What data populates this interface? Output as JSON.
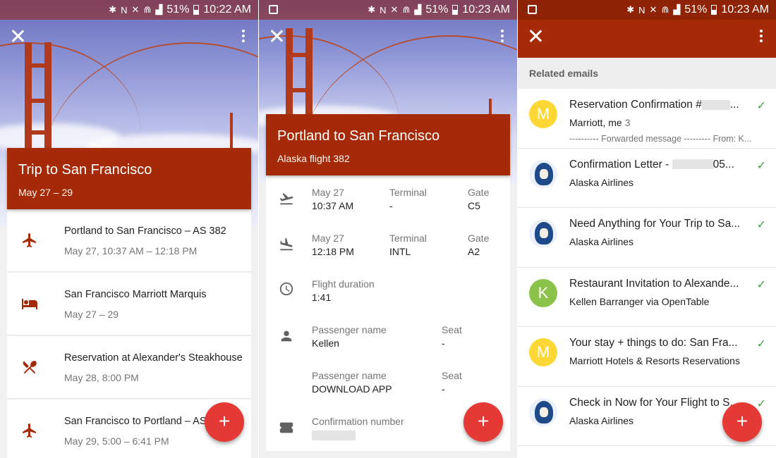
{
  "status_bars": [
    {
      "battery": "51%",
      "time": "10:22 AM"
    },
    {
      "battery": "51%",
      "time": "10:23 AM"
    },
    {
      "battery": "51%",
      "time": "10:23 AM"
    }
  ],
  "trip": {
    "title": "Trip to San Francisco",
    "dates": "May 27 – 29",
    "items": [
      {
        "icon": "airplane-icon",
        "title": "Portland to San Francisco – AS 382",
        "subtitle": "May 27, 10:37 AM – 12:18 PM"
      },
      {
        "icon": "hotel-bed-icon",
        "title": "San Francisco Marriott Marquis",
        "subtitle": "May 27 – 29"
      },
      {
        "icon": "restaurant-icon",
        "title": "Reservation at Alexander's Steakhouse",
        "subtitle": "May 28, 8:00 PM"
      },
      {
        "icon": "airplane-icon",
        "title": "San Francisco to Portland – AS",
        "subtitle": "May 29, 5:00 – 6:41 PM"
      }
    ]
  },
  "flight": {
    "title": "Portland to San Francisco",
    "subtitle": "Alaska flight 382",
    "departure": {
      "date": "May 27",
      "time": "10:37 AM",
      "terminal_label": "Terminal",
      "terminal": "-",
      "gate_label": "Gate",
      "gate": "C5"
    },
    "arrival": {
      "date": "May 27",
      "time": "12:18 PM",
      "terminal_label": "Terminal",
      "terminal": "INTL",
      "gate_label": "Gate",
      "gate": "A2"
    },
    "duration": {
      "label": "Flight duration",
      "value": "1:41"
    },
    "passengers": [
      {
        "label": "Passenger name",
        "name": "Kellen",
        "seat_label": "Seat",
        "seat": "-"
      },
      {
        "label": "Passenger name",
        "name": "DOWNLOAD APP",
        "seat_label": "Seat",
        "seat": "-"
      }
    ],
    "confirmation_label": "Confirmation number"
  },
  "emails": {
    "header": "Related emails",
    "items": [
      {
        "avatar": "M",
        "avatar_color": "#fdd835",
        "subject": "Reservation Confirmation #",
        "subject_suffix": "...",
        "from": "Marriott, me",
        "count": "3",
        "snippet": "---------- Forwarded message --------- From: K..."
      },
      {
        "avatar": "",
        "avatar_color": "#eaf1fa",
        "subject": "Confirmation Letter - ",
        "subject_suffix": "05...",
        "from": "Alaska Airlines",
        "count": "",
        "snippet": ""
      },
      {
        "avatar": "",
        "avatar_color": "#eaf1fa",
        "subject": "Need Anything for Your Trip to Sa...",
        "subject_suffix": "",
        "from": "Alaska Airlines",
        "count": "",
        "snippet": ""
      },
      {
        "avatar": "K",
        "avatar_color": "#8bc34a",
        "subject": "Restaurant Invitation to Alexande...",
        "subject_suffix": "",
        "from": "Kellen Barranger via OpenTable",
        "count": "",
        "snippet": ""
      },
      {
        "avatar": "M",
        "avatar_color": "#fdd835",
        "subject": "Your stay + things to do: San Fra...",
        "subject_suffix": "",
        "from": "Marriott Hotels & Resorts Reservations",
        "count": "",
        "snippet": ""
      },
      {
        "avatar": "",
        "avatar_color": "#eaf1fa",
        "subject": "Check in Now for Your Flight to S...",
        "subject_suffix": "",
        "from": "Alaska Airlines",
        "count": "",
        "snippet": ""
      }
    ]
  },
  "fab_label": "+",
  "colors": {
    "brand_red": "#a52a08",
    "fab_red": "#e53935",
    "check_green": "#43a047"
  }
}
